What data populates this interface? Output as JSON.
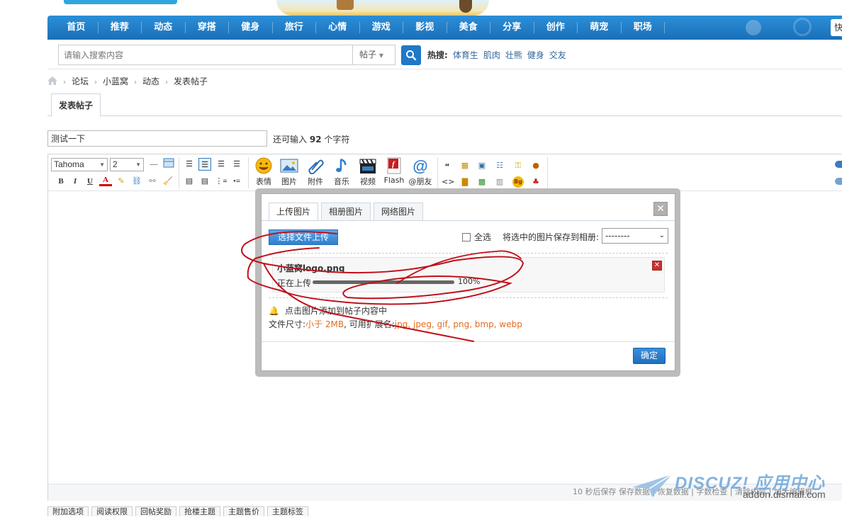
{
  "nav": {
    "items": [
      "首页",
      "推荐",
      "动态",
      "穿搭",
      "健身",
      "旅行",
      "心情",
      "游戏",
      "影视",
      "美食",
      "分享",
      "创作",
      "萌宠",
      "职场"
    ],
    "corner_text": "快"
  },
  "search": {
    "placeholder": "请输入搜索内容",
    "type": "帖子",
    "hot_label": "热搜:",
    "hot_keywords": [
      "体育生",
      "肌肉",
      "壮熊",
      "健身",
      "交友"
    ]
  },
  "breadcrumb": [
    "论坛",
    "小蓝窝",
    "动态",
    "发表帖子"
  ],
  "tabs": {
    "post": "发表帖子"
  },
  "title": {
    "value": "测试一下",
    "remain_prefix": "还可输入",
    "remain_count": "92",
    "remain_suffix": "个字符"
  },
  "toolbar": {
    "font": "Tahoma",
    "size": "2",
    "buttons": [
      "表情",
      "图片",
      "附件",
      "音乐",
      "视频",
      "Flash",
      "@朋友"
    ]
  },
  "dialog": {
    "tabs": [
      "上传图片",
      "相册图片",
      "网络图片"
    ],
    "upload_button": "选择文件上传",
    "select_all": "全选",
    "album_label": "将选中的图片保存到相册:",
    "album_value": "--------",
    "file": {
      "name": "小蓝窝logo.png",
      "status": "正在上传",
      "progress": 100,
      "percent_text": "100%"
    },
    "tip": "点击图片添加到帖子内容中",
    "size_prefix": "文件尺寸:",
    "size_value": "小于 2MB",
    "ext_prefix": ", 可用扩展名:",
    "ext_value": "jpg, jpeg, gif, png, bmp, webp",
    "ok": "确定"
  },
  "status_bar": "10 秒后保存 保存数据 | 恢复数据 | 字数检查 | 清除内容 | 加大编辑框",
  "bottom_tabs": [
    "附加选项",
    "阅读权限",
    "回帖奖励",
    "抢楼主题",
    "主题售价",
    "主题标签"
  ],
  "watermark": {
    "brand": "DISCUZ! 应用中心",
    "url": "addon.dismall.com"
  },
  "colors": {
    "nav_blue": "#2b8fd8",
    "accent_orange": "#e36c1c",
    "scribble_red": "#c0101a"
  }
}
